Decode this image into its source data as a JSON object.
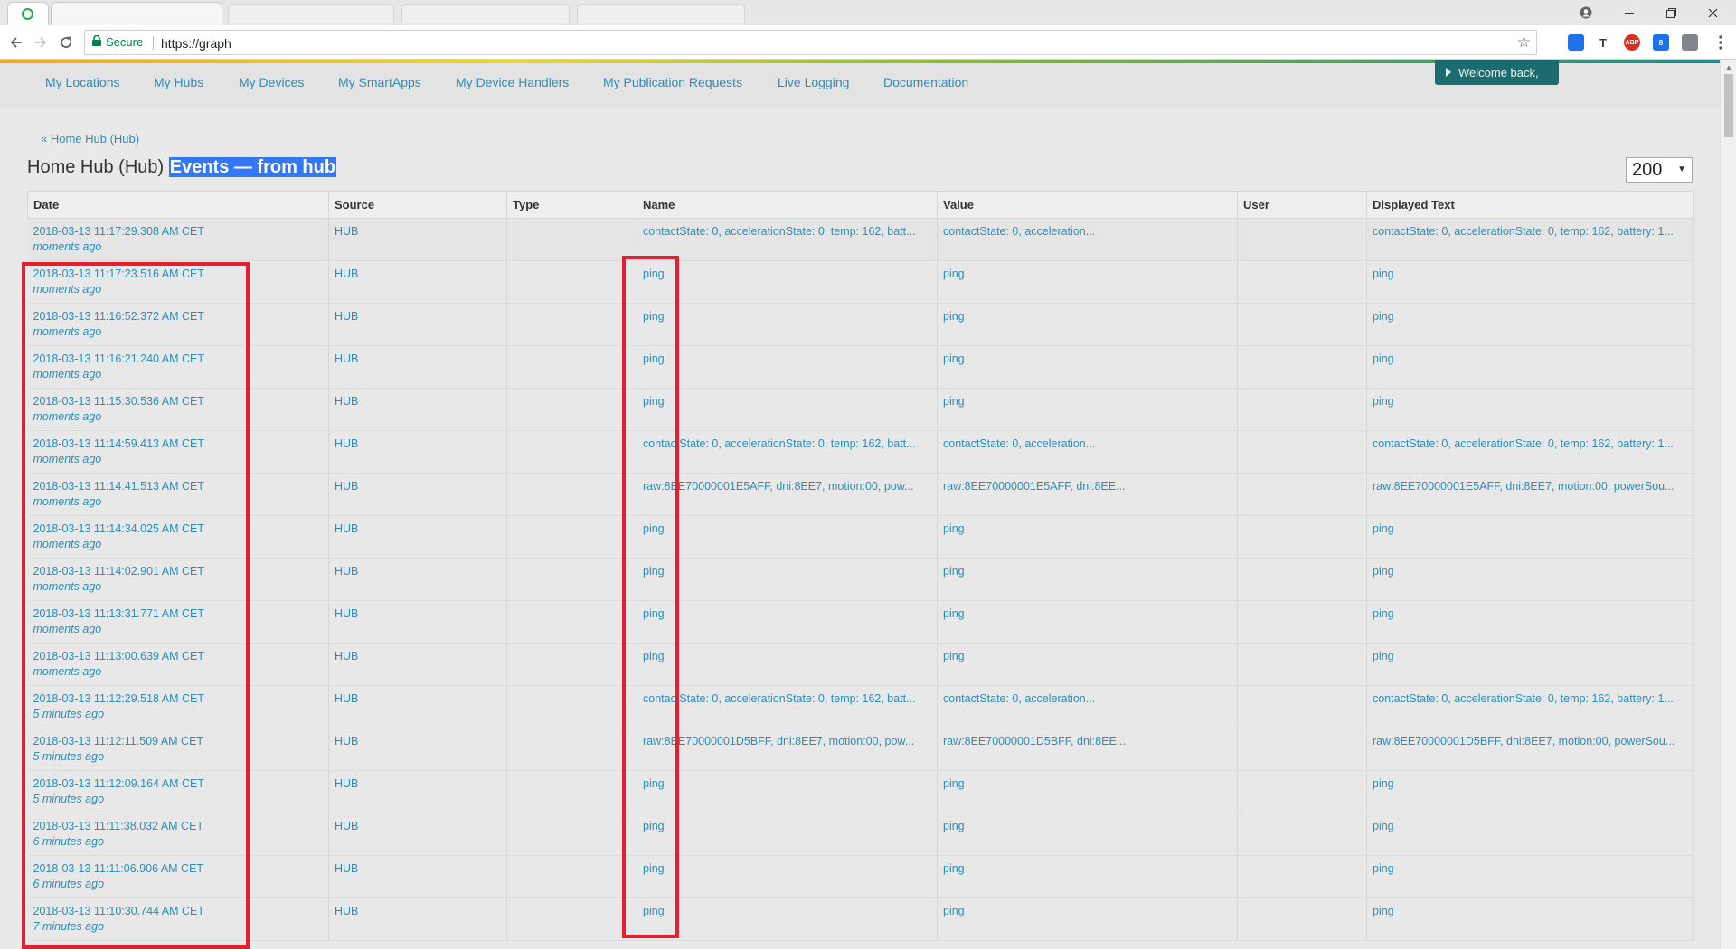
{
  "browser": {
    "secure_label": "Secure",
    "url": "https://graph",
    "icons": [
      "back-icon",
      "forward-icon",
      "reload-icon",
      "lock-icon",
      "star-icon",
      "menu-icon",
      "account-icon"
    ]
  },
  "extensions": [
    {
      "name": "extension-blue-icon",
      "color": "#1a73e8",
      "text": ""
    },
    {
      "name": "extension-t-icon",
      "color": "#3c4043",
      "text": "T"
    },
    {
      "name": "extension-abp-icon",
      "color": "#d93025",
      "text": "ABP"
    },
    {
      "name": "extension-badge-icon",
      "color": "#1a73e8",
      "text": "8"
    },
    {
      "name": "extension-gray-icon",
      "color": "#80868b",
      "text": ""
    }
  ],
  "nav": {
    "items": [
      "My Locations",
      "My Hubs",
      "My Devices",
      "My SmartApps",
      "My Device Handlers",
      "My Publication Requests",
      "Live Logging",
      "Documentation"
    ],
    "welcome": "Welcome back,"
  },
  "breadcrumb": "« Home Hub (Hub)",
  "title": {
    "prefix": "Home Hub (Hub)",
    "highlight": "Events — from hub"
  },
  "max_events": "200",
  "table": {
    "headers": [
      "Date",
      "Source",
      "Type",
      "Name",
      "Value",
      "User",
      "Displayed Text"
    ],
    "rows": [
      {
        "date": "2018-03-13 11:17:29.308 AM CET",
        "rel": "moments ago",
        "source": "HUB",
        "type": "",
        "name": "contactState: 0, accelerationState: 0, temp: 162, batt...",
        "value": "contactState: 0, acceleration...",
        "user": "",
        "text": "contactState: 0, accelerationState: 0, temp: 162, battery: 1..."
      },
      {
        "date": "2018-03-13 11:17:23.516 AM CET",
        "rel": "moments ago",
        "source": "HUB",
        "type": "",
        "name": "ping",
        "value": "ping",
        "user": "",
        "text": "ping"
      },
      {
        "date": "2018-03-13 11:16:52.372 AM CET",
        "rel": "moments ago",
        "source": "HUB",
        "type": "",
        "name": "ping",
        "value": "ping",
        "user": "",
        "text": "ping"
      },
      {
        "date": "2018-03-13 11:16:21.240 AM CET",
        "rel": "moments ago",
        "source": "HUB",
        "type": "",
        "name": "ping",
        "value": "ping",
        "user": "",
        "text": "ping"
      },
      {
        "date": "2018-03-13 11:15:30.536 AM CET",
        "rel": "moments ago",
        "source": "HUB",
        "type": "",
        "name": "ping",
        "value": "ping",
        "user": "",
        "text": "ping"
      },
      {
        "date": "2018-03-13 11:14:59.413 AM CET",
        "rel": "moments ago",
        "source": "HUB",
        "type": "",
        "name": "contactState: 0, accelerationState: 0, temp: 162, batt...",
        "value": "contactState: 0, acceleration...",
        "user": "",
        "text": "contactState: 0, accelerationState: 0, temp: 162, battery: 1..."
      },
      {
        "date": "2018-03-13 11:14:41.513 AM CET",
        "rel": "moments ago",
        "source": "HUB",
        "type": "",
        "name": "raw:8EE70000001E5AFF, dni:8EE7, motion:00, pow...",
        "value": "raw:8EE70000001E5AFF, dni:8EE...",
        "user": "",
        "text": "raw:8EE70000001E5AFF, dni:8EE7, motion:00, powerSou..."
      },
      {
        "date": "2018-03-13 11:14:34.025 AM CET",
        "rel": "moments ago",
        "source": "HUB",
        "type": "",
        "name": "ping",
        "value": "ping",
        "user": "",
        "text": "ping"
      },
      {
        "date": "2018-03-13 11:14:02.901 AM CET",
        "rel": "moments ago",
        "source": "HUB",
        "type": "",
        "name": "ping",
        "value": "ping",
        "user": "",
        "text": "ping"
      },
      {
        "date": "2018-03-13 11:13:31.771 AM CET",
        "rel": "moments ago",
        "source": "HUB",
        "type": "",
        "name": "ping",
        "value": "ping",
        "user": "",
        "text": "ping"
      },
      {
        "date": "2018-03-13 11:13:00.639 AM CET",
        "rel": "moments ago",
        "source": "HUB",
        "type": "",
        "name": "ping",
        "value": "ping",
        "user": "",
        "text": "ping"
      },
      {
        "date": "2018-03-13 11:12:29.518 AM CET",
        "rel": "5 minutes ago",
        "source": "HUB",
        "type": "",
        "name": "contactState: 0, accelerationState: 0, temp: 162, batt...",
        "value": "contactState: 0, acceleration...",
        "user": "",
        "text": "contactState: 0, accelerationState: 0, temp: 162, battery: 1..."
      },
      {
        "date": "2018-03-13 11:12:11.509 AM CET",
        "rel": "5 minutes ago",
        "source": "HUB",
        "type": "",
        "name": "raw:8EE70000001D5BFF, dni:8EE7, motion:00, pow...",
        "value": "raw:8EE70000001D5BFF, dni:8EE...",
        "user": "",
        "text": "raw:8EE70000001D5BFF, dni:8EE7, motion:00, powerSou..."
      },
      {
        "date": "2018-03-13 11:12:09.164 AM CET",
        "rel": "5 minutes ago",
        "source": "HUB",
        "type": "",
        "name": "ping",
        "value": "ping",
        "user": "",
        "text": "ping"
      },
      {
        "date": "2018-03-13 11:11:38.032 AM CET",
        "rel": "6 minutes ago",
        "source": "HUB",
        "type": "",
        "name": "ping",
        "value": "ping",
        "user": "",
        "text": "ping"
      },
      {
        "date": "2018-03-13 11:11:06.906 AM CET",
        "rel": "6 minutes ago",
        "source": "HUB",
        "type": "",
        "name": "ping",
        "value": "ping",
        "user": "",
        "text": "ping"
      },
      {
        "date": "2018-03-13 11:10:30.744 AM CET",
        "rel": "7 minutes ago",
        "source": "HUB",
        "type": "",
        "name": "ping",
        "value": "ping",
        "user": "",
        "text": "ping"
      }
    ]
  },
  "colors": {
    "link": "#2e8db5",
    "annotation": "#e4202e",
    "welcome_bg": "#1c6b6f",
    "highlight": "#3478f6"
  }
}
